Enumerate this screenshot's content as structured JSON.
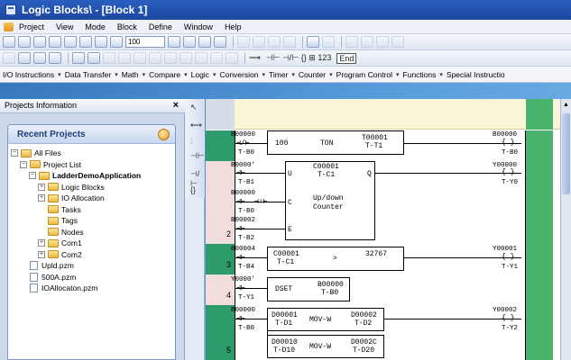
{
  "window": {
    "title": "Logic Blocks\\ - [Block 1]"
  },
  "menu": [
    "Project",
    "View",
    "Mode",
    "Block",
    "Define",
    "Window",
    "Help"
  ],
  "toolbar": {
    "zoom": "100",
    "symbols": "⊣⊢ ⊣/⊢ {} ⊞ 123",
    "end_label": "End"
  },
  "instruction_bar": [
    "I/O Instructions",
    "Data Transfer",
    "Math",
    "Compare",
    "Logic",
    "Conversion",
    "Timer",
    "Counter",
    "Program Control",
    "Functions",
    "Special Instructio"
  ],
  "projects_panel": {
    "header": "Projects Information",
    "recent_title": "Recent Projects",
    "tree": {
      "all_files": "All Files",
      "project_list": "Project List",
      "application": "LadderDemoApplication",
      "logic_blocks": "Logic Blocks",
      "io_allocation": "IO Allocation",
      "tasks": "Tasks",
      "tags": "Tags",
      "nodes": "Nodes",
      "com1": "Com1",
      "com2": "Com2",
      "file1": "Upld.pzm",
      "file2": "500A.pzm",
      "file3": "IOAllocaton.pzm"
    }
  },
  "ladder": {
    "rung1": {
      "contact1": "B00000",
      "contact1_sub": "T-B0",
      "val1": "100",
      "instr": "TON",
      "out_addr": "T00001",
      "out_sub": "T-T1",
      "coil": "B00000",
      "coil_sub": "T-B0"
    },
    "rung2": {
      "number": "2",
      "c1": "B0000'",
      "c1_sub": "T-B1",
      "c2": "B00000",
      "c2_sub": "T-B0",
      "c3": "B00002",
      "c3_sub": "T-B2",
      "counter_addr": "C00001",
      "counter_sub": "T-C1",
      "pin_u": "U",
      "pin_c": "C",
      "pin_e": "E",
      "pin_q": "Q",
      "counter_name": "Up/down",
      "counter_name2": "Counter",
      "coil": "Y00000",
      "coil_sub": "T-Y0"
    },
    "rung3": {
      "number": "3",
      "contact": "B00004",
      "contact_sub": "T-B4",
      "cmp_a": "C00001",
      "cmp_a_sub": "T-C1",
      "op": ">",
      "cmp_b": "32767",
      "coil": "Y00001",
      "coil_sub": "T-Y1"
    },
    "rung4": {
      "number": "4",
      "contact": "Y0000'",
      "contact_sub": "T-Y1",
      "instr": "DSET",
      "addr": "B00000",
      "addr_sub": "T-B0"
    },
    "rung5": {
      "number": "5",
      "contact": "B00000",
      "contact_sub": "T-B0",
      "src1": "D00001",
      "src1_sub": "T-D1",
      "instr1": "MOV-W",
      "dst1": "D00002",
      "dst1_sub": "T-D2",
      "src2": "D00010",
      "src2_sub": "T-D10",
      "instr2": "MOV-W",
      "dst2": "D0002C",
      "dst2_sub": "T-D20",
      "coil": "Y00002",
      "coil_sub": "T-Y2"
    }
  },
  "colors": {
    "title": "#1c47a0",
    "rail_green": "#49b36d",
    "header_yellow": "#fbf5d8"
  }
}
